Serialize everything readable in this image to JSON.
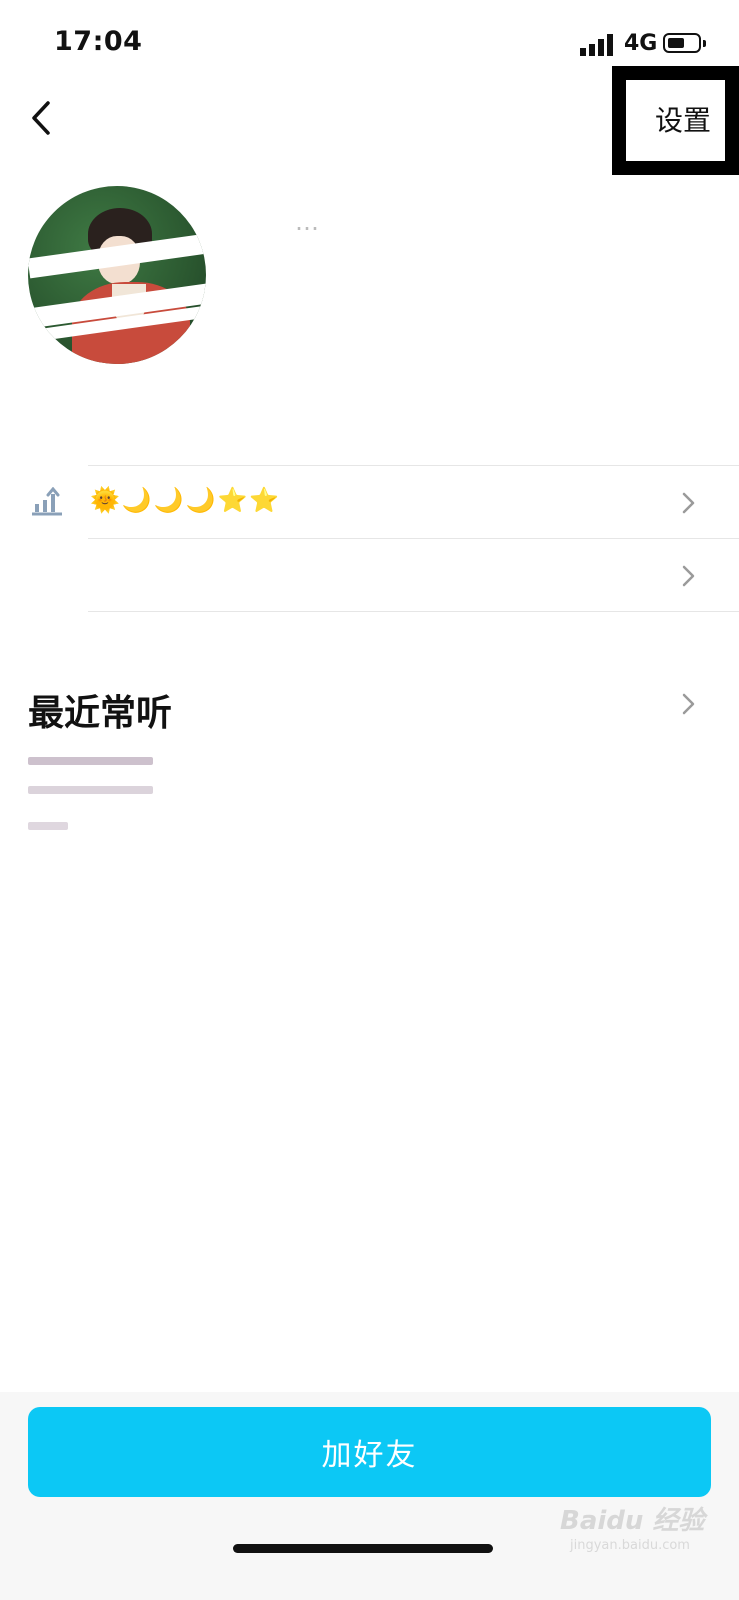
{
  "status_bar": {
    "time": "17:04",
    "network": "4G"
  },
  "nav": {
    "settings_label": "设置"
  },
  "profile": {
    "residual_text": "…"
  },
  "rows": [
    {
      "badges": "🌞🌙🌙🌙⭐⭐"
    }
  ],
  "recent": {
    "title": "最近常听"
  },
  "footer": {
    "add_friend_label": "加好友"
  },
  "watermark": {
    "brand": "Baidu 经验",
    "url": "jingyan.baidu.com"
  },
  "colors": {
    "accent": "#0cc8f5",
    "bottom_bg": "#f7f7f7"
  }
}
